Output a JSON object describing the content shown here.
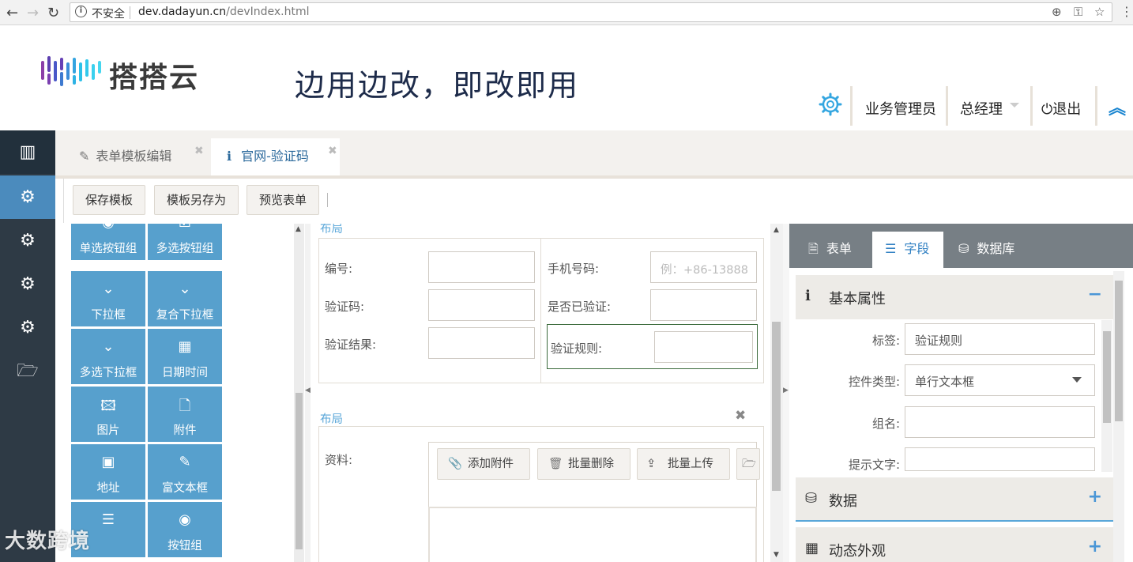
{
  "browser": {
    "security_label": "不安全",
    "url_host": "dev.dadayun.cn",
    "url_path": "/devIndex.html"
  },
  "header": {
    "logo_text": "搭搭云",
    "slogan": "边用边改，即改即用",
    "user_name": "业务管理员",
    "role": "总经理",
    "logout": "退出"
  },
  "tabs": [
    {
      "label": "表单模板编辑"
    },
    {
      "label": "官网-验证码"
    }
  ],
  "toolbar": {
    "save": "保存模板",
    "save_as": "模板另存为",
    "preview": "预览表单"
  },
  "palette": [
    {
      "label": "单选按钮组",
      "icon": "radio-icon"
    },
    {
      "label": "多选按钮组",
      "icon": "checkbox-icon"
    },
    {
      "label": "下拉框",
      "icon": "chevron-down-icon"
    },
    {
      "label": "复合下拉框",
      "icon": "chevron-down-icon"
    },
    {
      "label": "多选下拉框",
      "icon": "chevron-down-icon"
    },
    {
      "label": "日期时间",
      "icon": "calendar-icon"
    },
    {
      "label": "图片",
      "icon": "image-icon"
    },
    {
      "label": "附件",
      "icon": "file-icon"
    },
    {
      "label": "地址",
      "icon": "address-book-icon"
    },
    {
      "label": "富文本框",
      "icon": "edit-icon"
    },
    {
      "label": "",
      "icon": "list-icon"
    },
    {
      "label": "按钮组",
      "icon": "radio-icon"
    }
  ],
  "canvas": {
    "layout1_label": "布局",
    "layout2_label": "布局",
    "fields": {
      "number": "编号:",
      "code": "验证码:",
      "result": "验证结果:",
      "phone": "手机号码:",
      "phone_placeholder": "例：+86-13888",
      "verified": "是否已验证:",
      "rule": "验证规则:"
    },
    "attachment": {
      "label": "资料:",
      "add": "添加附件",
      "batch_delete": "批量删除",
      "batch_upload": "批量上传"
    }
  },
  "rpanel": {
    "tabs": [
      "表单",
      "字段",
      "数据库"
    ],
    "basic_section": "基本属性",
    "props": {
      "tag_label": "标签:",
      "tag_value": "验证规则",
      "type_label": "控件类型:",
      "type_value": "单行文本框",
      "group_label": "组名:",
      "hint_label": "提示文字:"
    },
    "data_section": "数据",
    "style_section": "动态外观"
  },
  "watermark": "大数跨境",
  "colors": {
    "accent": "#57a0cd",
    "sidebar": "#2e3a45",
    "link": "#3281c3"
  }
}
